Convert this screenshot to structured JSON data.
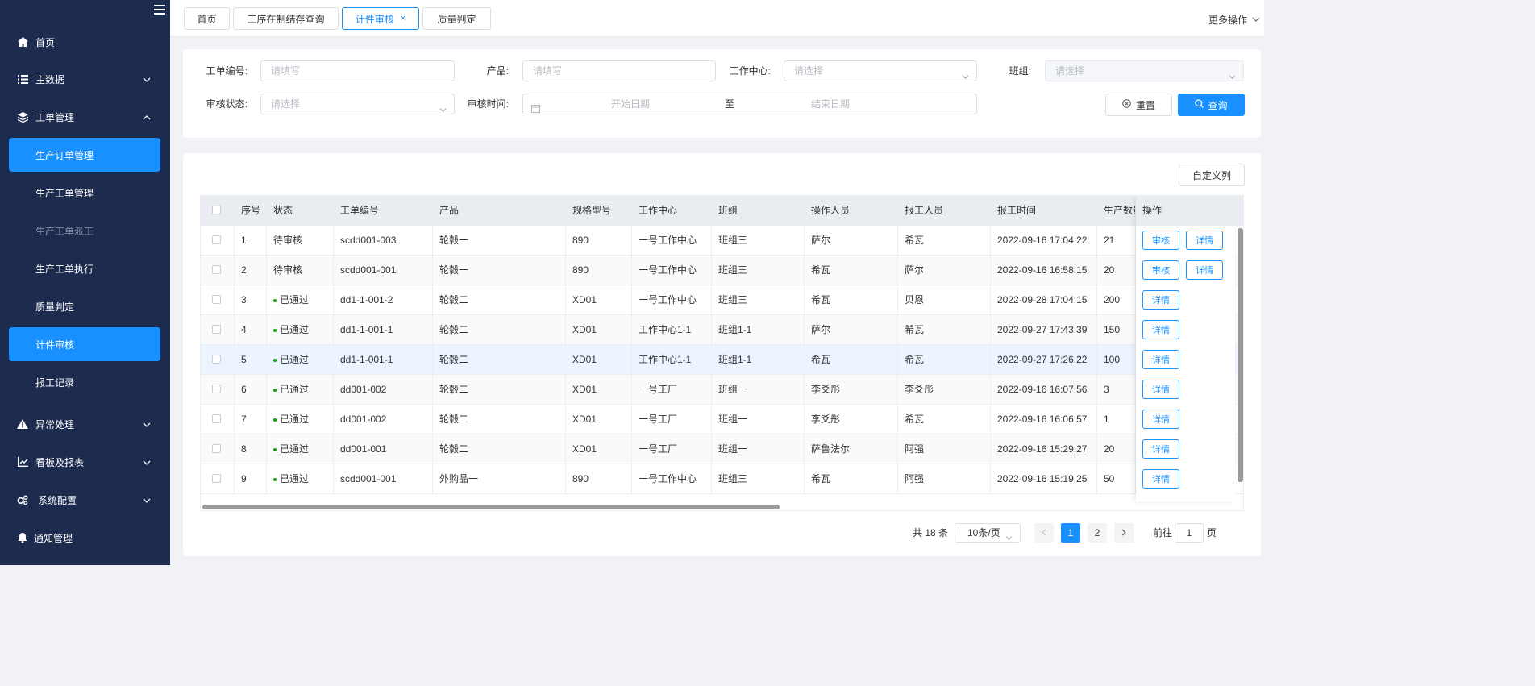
{
  "sidebar": {
    "items": [
      {
        "label": "首页"
      },
      {
        "label": "主数据"
      },
      {
        "label": "工单管理"
      },
      {
        "label": "异常处理"
      },
      {
        "label": "看板及报表"
      },
      {
        "label": "系统配置"
      },
      {
        "label": "通知管理"
      }
    ],
    "sub_items": [
      {
        "label": "生产订单管理"
      },
      {
        "label": "生产工单管理"
      },
      {
        "label": "生产工单派工"
      },
      {
        "label": "生产工单执行"
      },
      {
        "label": "质量判定"
      },
      {
        "label": "计件审核"
      },
      {
        "label": "报工记录"
      }
    ]
  },
  "tabs": [
    {
      "label": "首页"
    },
    {
      "label": "工序在制结存查询"
    },
    {
      "label": "计件审核",
      "close": "×"
    },
    {
      "label": "质量判定"
    }
  ],
  "more_ops": "更多操作",
  "filters": {
    "order_no_label": "工单编号:",
    "order_no_placeholder": "请填写",
    "product_label": "产品:",
    "product_placeholder": "请填写",
    "workcenter_label": "工作中心:",
    "workcenter_placeholder": "请选择",
    "team_label": "班组:",
    "team_placeholder": "请选择",
    "status_label": "审核状态:",
    "status_placeholder": "请选择",
    "time_label": "审核时间:",
    "start_placeholder": "开始日期",
    "range_sep": "至",
    "end_placeholder": "结束日期",
    "reset": "重置",
    "query": "查询"
  },
  "custom_columns": "自定义列",
  "table": {
    "headers": [
      "序号",
      "状态",
      "工单编号",
      "产品",
      "规格型号",
      "工作中心",
      "班组",
      "操作人员",
      "报工人员",
      "报工时间",
      "生产数量",
      "操作"
    ],
    "rows": [
      {
        "no": "1",
        "status": "待审核",
        "done": false,
        "order": "scdd001-003",
        "product": "轮毂一",
        "spec": "890",
        "wc": "一号工作中心",
        "team": "班组三",
        "op": "萨尔",
        "rep": "希瓦",
        "time": "2022-09-16 17:04:22",
        "qty": "21"
      },
      {
        "no": "2",
        "status": "待审核",
        "done": false,
        "order": "scdd001-001",
        "product": "轮毂一",
        "spec": "890",
        "wc": "一号工作中心",
        "team": "班组三",
        "op": "希瓦",
        "rep": "萨尔",
        "time": "2022-09-16 16:58:15",
        "qty": "20"
      },
      {
        "no": "3",
        "status": "已通过",
        "done": true,
        "order": "dd1-1-001-2",
        "product": "轮毂二",
        "spec": "XD01",
        "wc": "一号工作中心",
        "team": "班组三",
        "op": "希瓦",
        "rep": "贝恩",
        "time": "2022-09-28 17:04:15",
        "qty": "200"
      },
      {
        "no": "4",
        "status": "已通过",
        "done": true,
        "order": "dd1-1-001-1",
        "product": "轮毂二",
        "spec": "XD01",
        "wc": "工作中心1-1",
        "team": "班组1-1",
        "op": "萨尔",
        "rep": "希瓦",
        "time": "2022-09-27 17:43:39",
        "qty": "150"
      },
      {
        "no": "5",
        "status": "已通过",
        "done": true,
        "order": "dd1-1-001-1",
        "product": "轮毂二",
        "spec": "XD01",
        "wc": "工作中心1-1",
        "team": "班组1-1",
        "op": "希瓦",
        "rep": "希瓦",
        "time": "2022-09-27 17:26:22",
        "qty": "100"
      },
      {
        "no": "6",
        "status": "已通过",
        "done": true,
        "order": "dd001-002",
        "product": "轮毂二",
        "spec": "XD01",
        "wc": "一号工厂",
        "team": "班组一",
        "op": "李爻彤",
        "rep": "李爻彤",
        "time": "2022-09-16 16:07:56",
        "qty": "3"
      },
      {
        "no": "7",
        "status": "已通过",
        "done": true,
        "order": "dd001-002",
        "product": "轮毂二",
        "spec": "XD01",
        "wc": "一号工厂",
        "team": "班组一",
        "op": "李爻彤",
        "rep": "希瓦",
        "time": "2022-09-16 16:06:57",
        "qty": "1"
      },
      {
        "no": "8",
        "status": "已通过",
        "done": true,
        "order": "dd001-001",
        "product": "轮毂二",
        "spec": "XD01",
        "wc": "一号工厂",
        "team": "班组一",
        "op": "萨鲁法尔",
        "rep": "阿强",
        "time": "2022-09-16 15:29:27",
        "qty": "20"
      },
      {
        "no": "9",
        "status": "已通过",
        "done": true,
        "order": "scdd001-001",
        "product": "外购品一",
        "spec": "890",
        "wc": "一号工作中心",
        "team": "班组三",
        "op": "希瓦",
        "rep": "阿强",
        "time": "2022-09-16 15:19:25",
        "qty": "50"
      }
    ],
    "audit_btn": "审核",
    "detail_btn": "详情"
  },
  "pagination": {
    "total": "共 18 条",
    "page_size": "10条/页",
    "pages": [
      "1",
      "2"
    ],
    "goto_label": "前往",
    "goto_value": "1",
    "goto_suffix": "页"
  },
  "colors": {
    "sidebar_bg": "#1d2b4f",
    "primary": "#1890ff",
    "success_dot": "#13a10e"
  }
}
